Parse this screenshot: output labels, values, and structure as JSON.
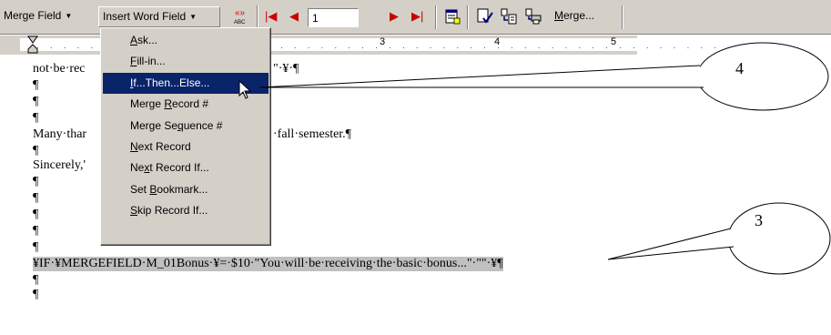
{
  "toolbar": {
    "merge_field_label": "Merge Field",
    "insert_word_field_label": "Insert Word Field",
    "record_number": "1",
    "merge_label_prefix": "",
    "merge_label_accel": "M",
    "merge_label_rest": "erge...",
    "dropdown_arrow": "▼",
    "nav_first": "|◀",
    "nav_prev": "◀",
    "nav_next": "▶",
    "nav_last": "▶|"
  },
  "ruler": {
    "numbers": [
      "3",
      "4",
      "5"
    ]
  },
  "menu": {
    "items": [
      {
        "pre": "",
        "acc": "A",
        "post": "sk..."
      },
      {
        "pre": "",
        "acc": "F",
        "post": "ill-in..."
      },
      {
        "pre": "",
        "acc": "I",
        "post": "f...Then...Else..."
      },
      {
        "pre": "Merge ",
        "acc": "R",
        "post": "ecord #"
      },
      {
        "pre": "Merge Se",
        "acc": "q",
        "post": "uence #"
      },
      {
        "pre": "",
        "acc": "N",
        "post": "ext Record"
      },
      {
        "pre": "Ne",
        "acc": "x",
        "post": "t Record If..."
      },
      {
        "pre": "Set ",
        "acc": "B",
        "post": "ookmark..."
      },
      {
        "pre": "",
        "acc": "S",
        "post": "kip Record If..."
      }
    ]
  },
  "document": {
    "line1_left": "not·be·rec",
    "line1_right": "\"·¥·¶",
    "line2": "¶",
    "line3": "¶",
    "line4": "¶",
    "line5_left": "Many·thar",
    "line5_right": "·fall·semester.¶",
    "line6": "¶",
    "line7": "Sincerely,'",
    "line8": "¶",
    "line9": "¶",
    "line10": "¶",
    "line11": "¶",
    "line12": "¶",
    "field_code": "¥IF·¥MERGEFIELD·M_01Bonus·¥=·$10·\"You·will·be·receiving·the·basic·bonus...\"·\"\"·¥¶",
    "line14": "¶",
    "line15": "¶"
  },
  "callouts": {
    "upper": "4",
    "lower": "3"
  }
}
